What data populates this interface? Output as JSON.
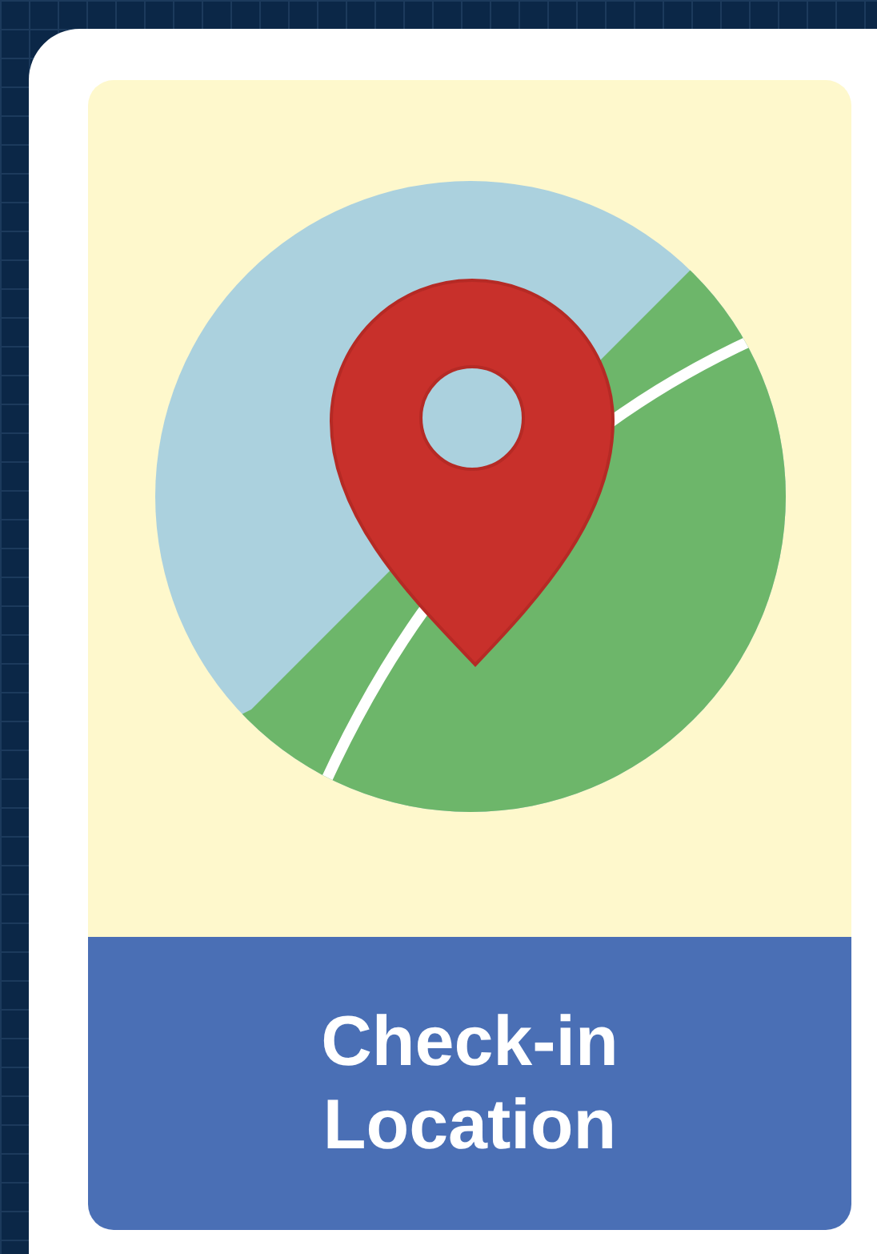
{
  "card": {
    "title": "Check-in Location"
  }
}
